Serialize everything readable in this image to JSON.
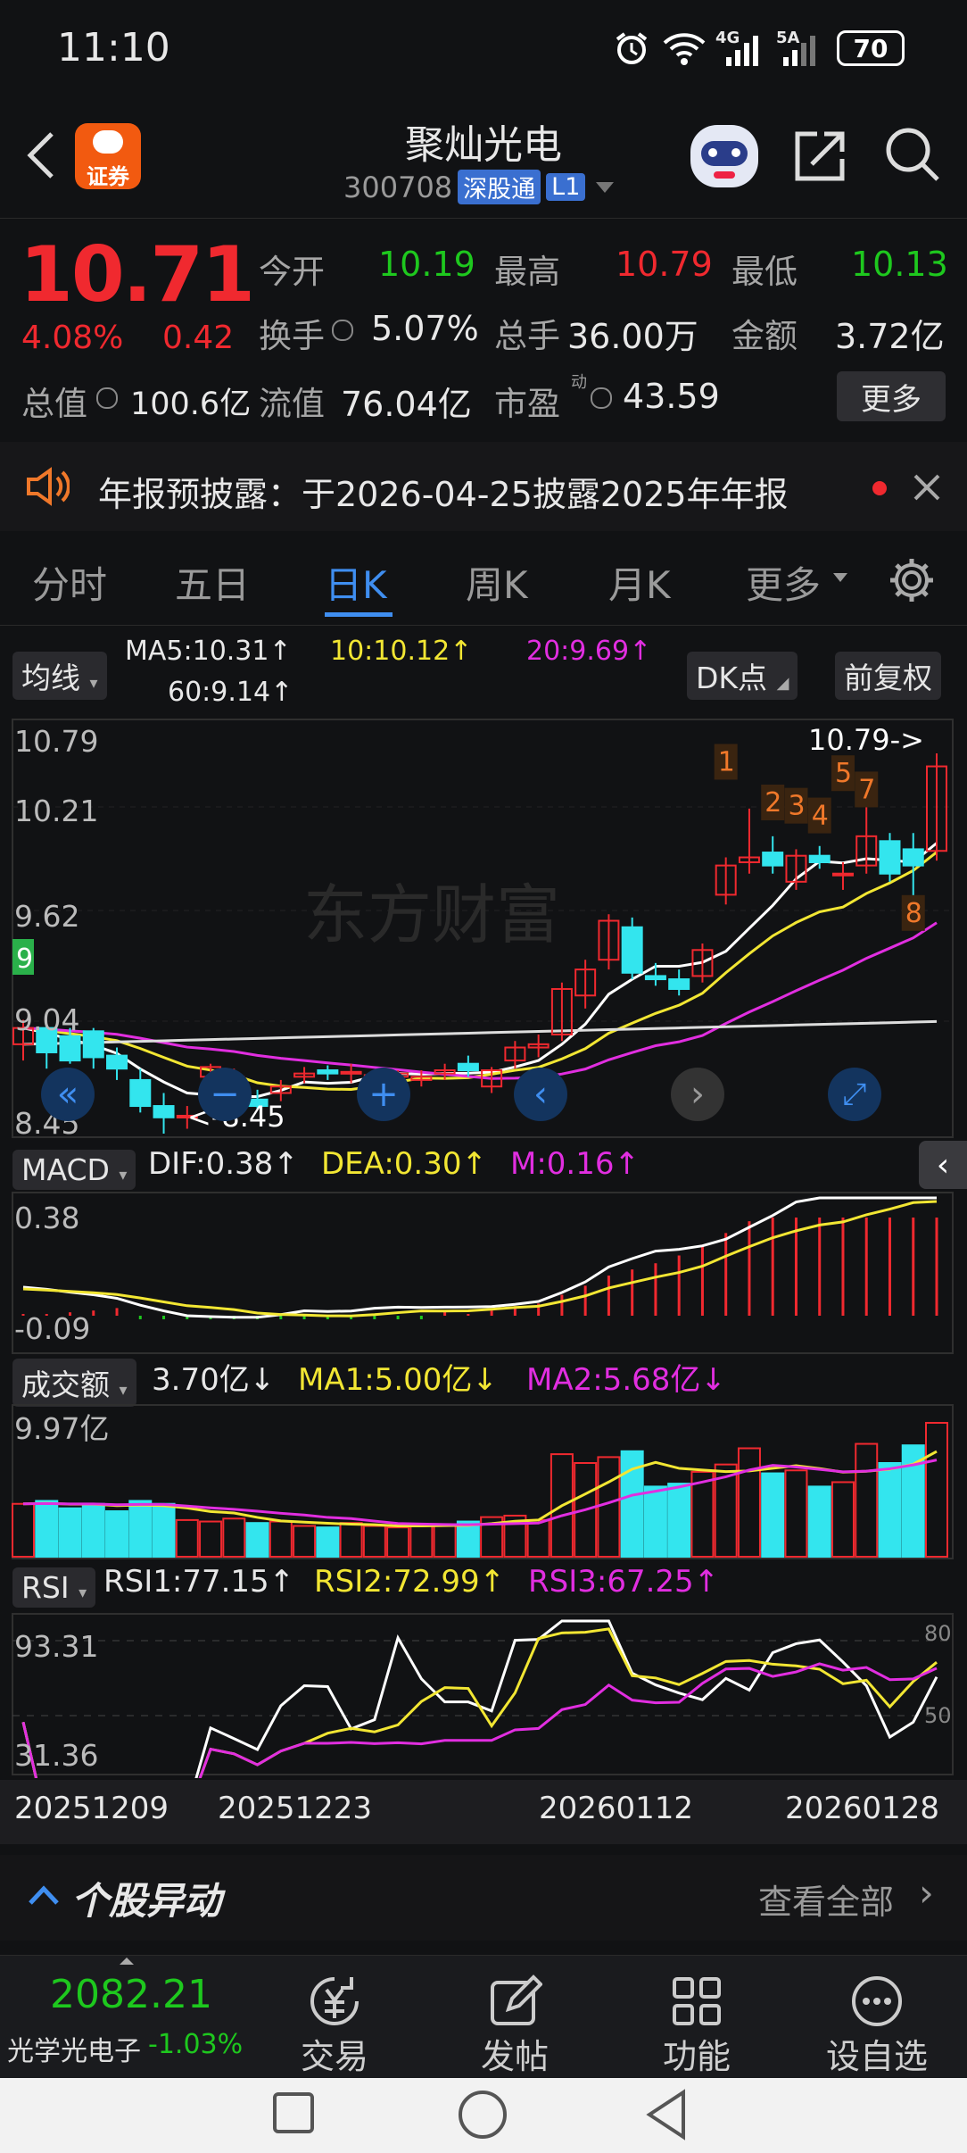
{
  "status_bar": {
    "time": "11:10",
    "net1": "4G",
    "net2": "5A",
    "battery": "70"
  },
  "header": {
    "title": "聚灿光电",
    "code": "300708",
    "badge": "深股通",
    "level": "L1",
    "logo_label": "证券"
  },
  "quote": {
    "price": "10.71",
    "change_pct": "4.08%",
    "change_abs": "0.42",
    "open_label": "今开",
    "open": "10.19",
    "high_label": "最高",
    "high": "10.79",
    "low_label": "最低",
    "low": "10.13",
    "turnover_label": "换手",
    "turnover": "5.07%",
    "volume_label": "总手",
    "volume": "36.00万",
    "amount_label": "金额",
    "amount": "3.72亿",
    "mktcap_label": "总值",
    "mktcap": "100.6亿",
    "float_label": "流值",
    "float": "76.04亿",
    "pe_label": "市盈",
    "pe_sup": "动",
    "pe": "43.59",
    "more_button": "更多"
  },
  "notice": {
    "text": "年报预披露：于2026-04-25披露2025年年报"
  },
  "tabs": [
    {
      "label": "分时"
    },
    {
      "label": "五日"
    },
    {
      "label": "日K"
    },
    {
      "label": "周K"
    },
    {
      "label": "月K"
    },
    {
      "label": "更多"
    }
  ],
  "main_chart": {
    "indicator_chip": "均线",
    "ma5": "MA5:10.31↑",
    "ma10": "10:10.12↑",
    "ma20": "20:9.69↑",
    "ma60": "60:9.14↑",
    "dk_chip": "DK点",
    "adj_chip": "前复权",
    "watermark": "东方财富",
    "max_label": "10.79->",
    "min_label": "<-8.45",
    "signal_9": "9",
    "signals": [
      "1",
      "2",
      "3",
      "4",
      "5",
      "7",
      "8"
    ]
  },
  "macd": {
    "chip": "MACD",
    "dif": "DIF:0.38↑",
    "dea": "DEA:0.30↑",
    "m": "M:0.16↑"
  },
  "volume": {
    "chip": "成交额",
    "value": "3.70亿↓",
    "ma1": "MA1:5.00亿↓",
    "ma2": "MA2:5.68亿↓",
    "max_label": "9.97亿"
  },
  "rsi": {
    "chip": "RSI",
    "rsi1": "RSI1:77.15↑",
    "rsi2": "RSI2:72.99↑",
    "rsi3": "RSI3:67.25↑"
  },
  "dates": [
    "20251209",
    "20251223",
    "20260112",
    "20260128"
  ],
  "movers": {
    "title": "个股异动",
    "view_all": "查看全部"
  },
  "bottom": {
    "index_value": "2082.21",
    "index_name": "光学光电子",
    "index_change": "-1.03%",
    "trade": "交易",
    "post": "发帖",
    "functions": "功能",
    "watchlist": "设自选"
  },
  "chart_data": [
    {
      "type": "candlestick",
      "title": "日K",
      "ylim": [
        8.45,
        10.79
      ],
      "y_ticks": [
        "10.79",
        "10.21",
        "9.62",
        "9.04",
        "8.45"
      ],
      "ohlc": [
        [
          9.0,
          9.15,
          8.9,
          9.1
        ],
        [
          9.1,
          9.12,
          8.85,
          8.95
        ],
        [
          9.05,
          9.1,
          8.88,
          8.9
        ],
        [
          9.08,
          9.1,
          8.85,
          8.92
        ],
        [
          8.93,
          8.98,
          8.78,
          8.85
        ],
        [
          8.78,
          8.85,
          8.58,
          8.62
        ],
        [
          8.62,
          8.7,
          8.45,
          8.55
        ],
        [
          8.56,
          8.62,
          8.48,
          8.56
        ],
        [
          8.8,
          8.88,
          8.75,
          8.86
        ],
        [
          8.78,
          8.85,
          8.7,
          8.8
        ],
        [
          8.66,
          8.72,
          8.6,
          8.62
        ],
        [
          8.7,
          8.78,
          8.65,
          8.74
        ],
        [
          8.8,
          8.86,
          8.76,
          8.82
        ],
        [
          8.84,
          8.87,
          8.78,
          8.82
        ],
        [
          8.82,
          8.88,
          8.76,
          8.83
        ],
        [
          8.79,
          8.84,
          8.74,
          8.81
        ],
        [
          8.8,
          8.84,
          8.75,
          8.82
        ],
        [
          8.78,
          8.84,
          8.74,
          8.8
        ],
        [
          8.82,
          8.88,
          8.78,
          8.84
        ],
        [
          8.88,
          8.93,
          8.8,
          8.84
        ],
        [
          8.74,
          8.86,
          8.7,
          8.84
        ],
        [
          8.9,
          9.02,
          8.85,
          8.98
        ],
        [
          8.98,
          9.06,
          8.92,
          9.0
        ],
        [
          9.06,
          9.38,
          9.02,
          9.34
        ],
        [
          9.3,
          9.52,
          9.22,
          9.46
        ],
        [
          9.52,
          9.8,
          9.46,
          9.76
        ],
        [
          9.72,
          9.78,
          9.4,
          9.44
        ],
        [
          9.42,
          9.5,
          9.36,
          9.4
        ],
        [
          9.4,
          9.46,
          9.3,
          9.34
        ],
        [
          9.42,
          9.62,
          9.38,
          9.58
        ],
        [
          9.92,
          10.15,
          9.86,
          10.1
        ],
        [
          10.12,
          10.45,
          10.05,
          10.15
        ],
        [
          10.18,
          10.28,
          10.05,
          10.1
        ],
        [
          10.0,
          10.2,
          9.95,
          10.16
        ],
        [
          10.16,
          10.22,
          10.08,
          10.12
        ],
        [
          10.05,
          10.12,
          9.95,
          10.05
        ],
        [
          10.1,
          10.48,
          10.05,
          10.28
        ],
        [
          10.25,
          10.3,
          10.0,
          10.05
        ],
        [
          10.2,
          10.3,
          9.88,
          10.1
        ],
        [
          10.19,
          10.79,
          10.13,
          10.71
        ]
      ],
      "ma5_last": 10.31,
      "ma10_last": 10.12,
      "ma20_last": 9.69,
      "ma60_last": 9.14
    },
    {
      "type": "bar",
      "title": "MACD",
      "y_ticks": [
        "0.38",
        "-0.09"
      ],
      "dif_last": 0.38,
      "dea_last": 0.3,
      "m_last": 0.16
    },
    {
      "type": "bar",
      "title": "成交额",
      "y_ticks": [
        "9.97亿"
      ],
      "last": "3.70亿",
      "ma1": "5.00亿",
      "ma2": "5.68亿"
    },
    {
      "type": "line",
      "title": "RSI",
      "y_ticks": [
        "93.31",
        "31.36",
        "80",
        "50"
      ],
      "rsi1_last": 77.15,
      "rsi2_last": 72.99,
      "rsi3_last": 67.25
    }
  ]
}
